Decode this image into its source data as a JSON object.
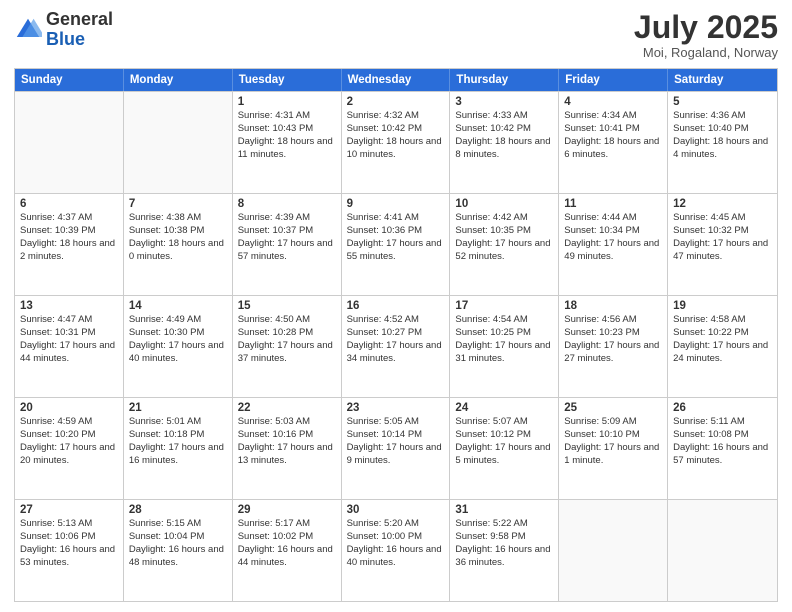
{
  "logo": {
    "general": "General",
    "blue": "Blue"
  },
  "title": "July 2025",
  "location": "Moi, Rogaland, Norway",
  "days_of_week": [
    "Sunday",
    "Monday",
    "Tuesday",
    "Wednesday",
    "Thursday",
    "Friday",
    "Saturday"
  ],
  "weeks": [
    [
      {
        "day": "",
        "info": ""
      },
      {
        "day": "",
        "info": ""
      },
      {
        "day": "1",
        "info": "Sunrise: 4:31 AM\nSunset: 10:43 PM\nDaylight: 18 hours and 11 minutes."
      },
      {
        "day": "2",
        "info": "Sunrise: 4:32 AM\nSunset: 10:42 PM\nDaylight: 18 hours and 10 minutes."
      },
      {
        "day": "3",
        "info": "Sunrise: 4:33 AM\nSunset: 10:42 PM\nDaylight: 18 hours and 8 minutes."
      },
      {
        "day": "4",
        "info": "Sunrise: 4:34 AM\nSunset: 10:41 PM\nDaylight: 18 hours and 6 minutes."
      },
      {
        "day": "5",
        "info": "Sunrise: 4:36 AM\nSunset: 10:40 PM\nDaylight: 18 hours and 4 minutes."
      }
    ],
    [
      {
        "day": "6",
        "info": "Sunrise: 4:37 AM\nSunset: 10:39 PM\nDaylight: 18 hours and 2 minutes."
      },
      {
        "day": "7",
        "info": "Sunrise: 4:38 AM\nSunset: 10:38 PM\nDaylight: 18 hours and 0 minutes."
      },
      {
        "day": "8",
        "info": "Sunrise: 4:39 AM\nSunset: 10:37 PM\nDaylight: 17 hours and 57 minutes."
      },
      {
        "day": "9",
        "info": "Sunrise: 4:41 AM\nSunset: 10:36 PM\nDaylight: 17 hours and 55 minutes."
      },
      {
        "day": "10",
        "info": "Sunrise: 4:42 AM\nSunset: 10:35 PM\nDaylight: 17 hours and 52 minutes."
      },
      {
        "day": "11",
        "info": "Sunrise: 4:44 AM\nSunset: 10:34 PM\nDaylight: 17 hours and 49 minutes."
      },
      {
        "day": "12",
        "info": "Sunrise: 4:45 AM\nSunset: 10:32 PM\nDaylight: 17 hours and 47 minutes."
      }
    ],
    [
      {
        "day": "13",
        "info": "Sunrise: 4:47 AM\nSunset: 10:31 PM\nDaylight: 17 hours and 44 minutes."
      },
      {
        "day": "14",
        "info": "Sunrise: 4:49 AM\nSunset: 10:30 PM\nDaylight: 17 hours and 40 minutes."
      },
      {
        "day": "15",
        "info": "Sunrise: 4:50 AM\nSunset: 10:28 PM\nDaylight: 17 hours and 37 minutes."
      },
      {
        "day": "16",
        "info": "Sunrise: 4:52 AM\nSunset: 10:27 PM\nDaylight: 17 hours and 34 minutes."
      },
      {
        "day": "17",
        "info": "Sunrise: 4:54 AM\nSunset: 10:25 PM\nDaylight: 17 hours and 31 minutes."
      },
      {
        "day": "18",
        "info": "Sunrise: 4:56 AM\nSunset: 10:23 PM\nDaylight: 17 hours and 27 minutes."
      },
      {
        "day": "19",
        "info": "Sunrise: 4:58 AM\nSunset: 10:22 PM\nDaylight: 17 hours and 24 minutes."
      }
    ],
    [
      {
        "day": "20",
        "info": "Sunrise: 4:59 AM\nSunset: 10:20 PM\nDaylight: 17 hours and 20 minutes."
      },
      {
        "day": "21",
        "info": "Sunrise: 5:01 AM\nSunset: 10:18 PM\nDaylight: 17 hours and 16 minutes."
      },
      {
        "day": "22",
        "info": "Sunrise: 5:03 AM\nSunset: 10:16 PM\nDaylight: 17 hours and 13 minutes."
      },
      {
        "day": "23",
        "info": "Sunrise: 5:05 AM\nSunset: 10:14 PM\nDaylight: 17 hours and 9 minutes."
      },
      {
        "day": "24",
        "info": "Sunrise: 5:07 AM\nSunset: 10:12 PM\nDaylight: 17 hours and 5 minutes."
      },
      {
        "day": "25",
        "info": "Sunrise: 5:09 AM\nSunset: 10:10 PM\nDaylight: 17 hours and 1 minute."
      },
      {
        "day": "26",
        "info": "Sunrise: 5:11 AM\nSunset: 10:08 PM\nDaylight: 16 hours and 57 minutes."
      }
    ],
    [
      {
        "day": "27",
        "info": "Sunrise: 5:13 AM\nSunset: 10:06 PM\nDaylight: 16 hours and 53 minutes."
      },
      {
        "day": "28",
        "info": "Sunrise: 5:15 AM\nSunset: 10:04 PM\nDaylight: 16 hours and 48 minutes."
      },
      {
        "day": "29",
        "info": "Sunrise: 5:17 AM\nSunset: 10:02 PM\nDaylight: 16 hours and 44 minutes."
      },
      {
        "day": "30",
        "info": "Sunrise: 5:20 AM\nSunset: 10:00 PM\nDaylight: 16 hours and 40 minutes."
      },
      {
        "day": "31",
        "info": "Sunrise: 5:22 AM\nSunset: 9:58 PM\nDaylight: 16 hours and 36 minutes."
      },
      {
        "day": "",
        "info": ""
      },
      {
        "day": "",
        "info": ""
      }
    ]
  ]
}
